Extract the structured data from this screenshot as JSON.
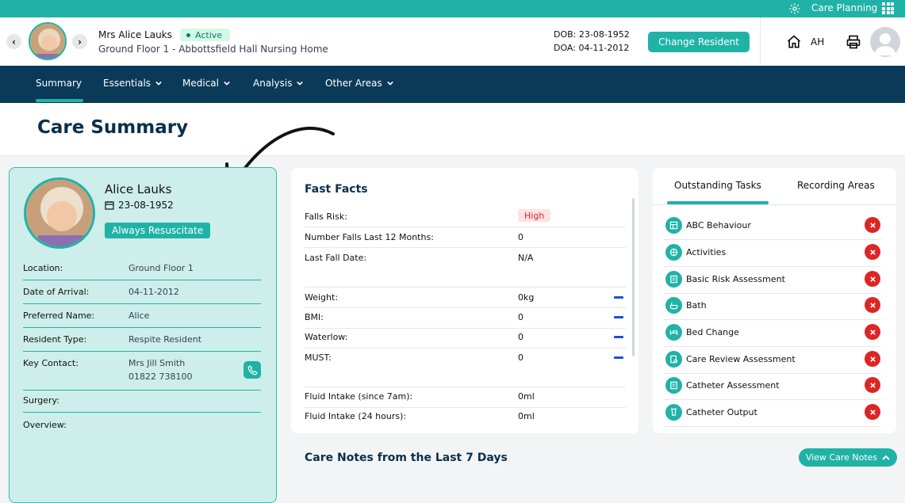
{
  "topbar": {
    "title": "Care Planning",
    "icons": [
      "gear-icon",
      "apps-grid-icon"
    ]
  },
  "resident_header": {
    "name": "Mrs Alice Lauks",
    "status": "Active",
    "location": "Ground Floor 1 - Abbottsfield Hall Nursing Home",
    "dob": "DOB: 23-08-1952",
    "doa": "DOA: 04-11-2012",
    "change_button": "Change Resident",
    "initials": "AH"
  },
  "nav": {
    "items": [
      "Summary",
      "Essentials",
      "Medical",
      "Analysis",
      "Other Areas"
    ],
    "active": "Summary"
  },
  "page_title": "Care Summary",
  "profile": {
    "name": "Alice Lauks",
    "dob": "23-08-1952",
    "badge": "Always Resuscitate",
    "rows": [
      {
        "label": "Location:",
        "value": "Ground Floor 1"
      },
      {
        "label": "Date of Arrival:",
        "value": "04-11-2012"
      },
      {
        "label": "Preferred Name:",
        "value": "Alice"
      },
      {
        "label": "Resident Type:",
        "value": "Respite Resident"
      },
      {
        "label": "Key Contact:",
        "value": "Mrs Jill Smith",
        "value2": "01822 738100"
      },
      {
        "label": "Surgery:",
        "value": ""
      },
      {
        "label": "Overview:",
        "value": ""
      }
    ]
  },
  "fast_facts": {
    "title": "Fast Facts",
    "rows": [
      {
        "label": "Falls Risk:",
        "value": "High"
      },
      {
        "label": "Number Falls Last 12 Months:",
        "value": "0"
      },
      {
        "label": "Last Fall Date:",
        "value": "N/A"
      },
      {
        "label": "Weight:",
        "value": "0kg"
      },
      {
        "label": "BMI:",
        "value": "0"
      },
      {
        "label": "Waterlow:",
        "value": "0"
      },
      {
        "label": "MUST:",
        "value": "0"
      },
      {
        "label": "Fluid Intake (since 7am):",
        "value": "0ml"
      },
      {
        "label": "Fluid Intake (24 hours):",
        "value": "0ml"
      }
    ]
  },
  "tasks": {
    "tabs": [
      "Outstanding Tasks",
      "Recording Areas"
    ],
    "items": [
      "ABC Behaviour",
      "Activities",
      "Basic Risk Assessment",
      "Bath",
      "Bed Change",
      "Care Review Assessment",
      "Catheter Assessment",
      "Catheter Output"
    ]
  },
  "care_notes": {
    "title": "Care Notes from the Last 7 Days",
    "button": "View Care Notes"
  },
  "colors": {
    "teal": "#20b2a6",
    "navy": "#0b3a59",
    "danger": "#dc2626"
  }
}
